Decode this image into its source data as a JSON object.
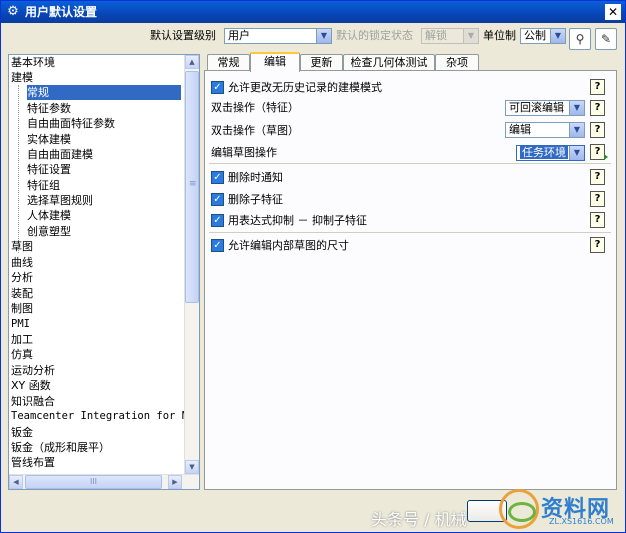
{
  "window": {
    "title": "用户默认设置"
  },
  "topbar": {
    "level_label": "默认设置级别",
    "level_value": "用户",
    "lock_label": "默认的锁定状态",
    "lock_value": "解锁",
    "unit_label": "单位制",
    "unit_value": "公制"
  },
  "tree": {
    "items": [
      {
        "label": "基本环境"
      },
      {
        "label": "建模"
      },
      {
        "label": "常规"
      },
      {
        "label": "特征参数"
      },
      {
        "label": "自由曲面特征参数"
      },
      {
        "label": "实体建模"
      },
      {
        "label": "自由曲面建模"
      },
      {
        "label": "特征设置"
      },
      {
        "label": "特征组"
      },
      {
        "label": "选择草图规则"
      },
      {
        "label": "人体建模"
      },
      {
        "label": "创意塑型"
      },
      {
        "label": "草图"
      },
      {
        "label": "曲线"
      },
      {
        "label": "分析"
      },
      {
        "label": "装配"
      },
      {
        "label": "制图"
      },
      {
        "label": "PMI"
      },
      {
        "label": "加工"
      },
      {
        "label": "仿真"
      },
      {
        "label": "运动分析"
      },
      {
        "label": "XY 函数"
      },
      {
        "label": "知识融合"
      },
      {
        "label": "Teamcenter Integration for N"
      },
      {
        "label": "钣金"
      },
      {
        "label": "钣金（成形和展平）"
      },
      {
        "label": "管线布置"
      }
    ],
    "hscroll_grip": "III",
    "vscroll_grip": "≡"
  },
  "tabs": [
    {
      "label": "常规"
    },
    {
      "label": "编辑"
    },
    {
      "label": "更新"
    },
    {
      "label": "检查几何体测试"
    },
    {
      "label": "杂项"
    }
  ],
  "panel": {
    "allow_change": "允许更改无历史记录的建模模式",
    "dblclick_feature_label": "双击操作（特征）",
    "dblclick_feature_value": "可回滚编辑",
    "dblclick_sketch_label": "双击操作（草图）",
    "dblclick_sketch_value": "编辑",
    "edit_sketch_label": "编辑草图操作",
    "edit_sketch_value": "任务环境",
    "delete_notify": "删除时通知",
    "delete_children": "删除子特征",
    "expr_suppress": "用表达式抑制 － 抑制子特征",
    "allow_inner_sketch": "允许编辑内部草图的尺寸",
    "help": "?"
  },
  "watermark": {
    "toutiao": "头条号 / 机械",
    "site": "资料网",
    "site_url": "ZL.XS1616.COM"
  },
  "colors": {
    "selection": "#316AC5",
    "titlebar": "#0A5FD8",
    "check": "#2A7AE2"
  }
}
